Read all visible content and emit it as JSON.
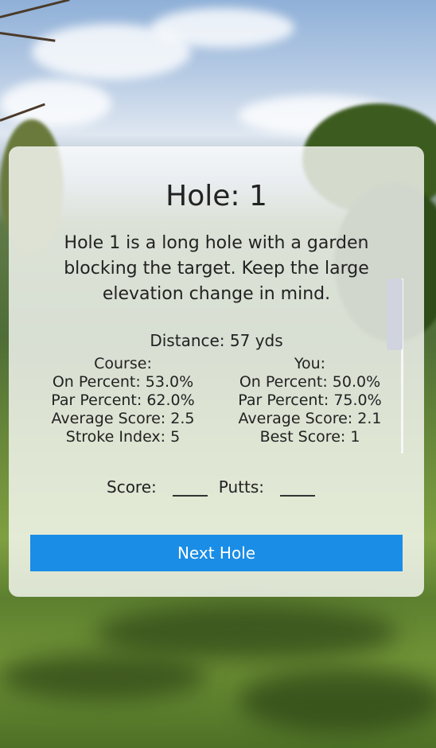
{
  "hole": {
    "title": "Hole: 1",
    "description": "Hole 1 is a long hole with a garden blocking the target. Keep the large elevation change in mind.",
    "distance": "Distance: 57 yds"
  },
  "course": {
    "header": "Course:",
    "on_percent": "On Percent: 53.0%",
    "par_percent": "Par Percent: 62.0%",
    "average_score": "Average Score: 2.5",
    "stroke_index": "Stroke Index: 5"
  },
  "you": {
    "header": "You:",
    "on_percent": "On Percent: 50.0%",
    "par_percent": "Par Percent: 75.0%",
    "average_score": "Average Score: 2.1",
    "best_score": "Best Score: 1"
  },
  "entry": {
    "score_label": "Score:",
    "score_value": "",
    "putts_label": "Putts:",
    "putts_value": ""
  },
  "actions": {
    "next_label": "Next Hole"
  },
  "colors": {
    "accent": "#1a8de6"
  }
}
